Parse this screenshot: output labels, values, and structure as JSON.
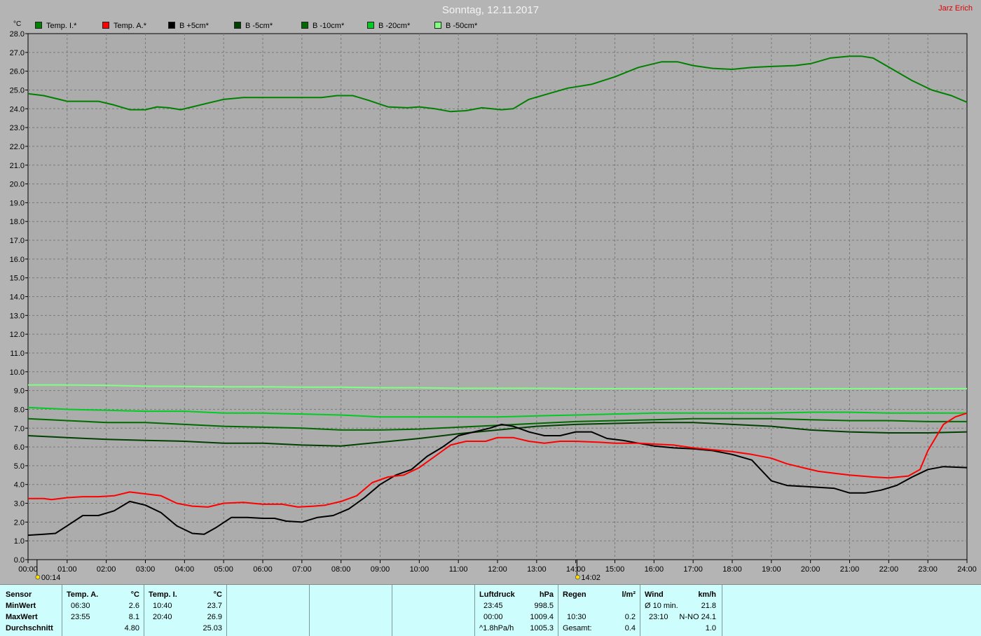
{
  "title": "Sonntag, 12.11.2017",
  "author": "Jarz Erich",
  "colors": {
    "temp_i": "#008000",
    "temp_a": "#ff0000",
    "b_plus5": "#000000",
    "b_minus5": "#004000",
    "b_minus10": "#006a00",
    "b_minus20": "#00cc22",
    "b_minus50": "#80ff80"
  },
  "chart_data": {
    "type": "line",
    "ylabel": "°C",
    "ylim": [
      0,
      28
    ],
    "xlim": [
      0,
      24
    ],
    "grid": true,
    "legend_placement": "top",
    "y_ticks": [
      "0.0",
      "1.0",
      "2.0",
      "3.0",
      "4.0",
      "5.0",
      "6.0",
      "7.0",
      "8.0",
      "9.0",
      "10.0",
      "11.0",
      "12.0",
      "13.0",
      "14.0",
      "15.0",
      "16.0",
      "17.0",
      "18.0",
      "19.0",
      "20.0",
      "21.0",
      "22.0",
      "23.0",
      "24.0",
      "25.0",
      "26.0",
      "27.0",
      "28.0"
    ],
    "x_ticks": [
      "00:00",
      "01:00",
      "02:00",
      "03:00",
      "04:00",
      "05:00",
      "06:00",
      "07:00",
      "08:00",
      "09:00",
      "10:00",
      "11:00",
      "12:00",
      "13:00",
      "14:00",
      "15:00",
      "16:00",
      "17:00",
      "18:00",
      "19:00",
      "20:00",
      "21:00",
      "22:00",
      "23:00",
      "24:00"
    ],
    "markers": [
      {
        "x": 0.23,
        "label": "00:14"
      },
      {
        "x": 14.03,
        "label": "14:02"
      }
    ],
    "series": [
      {
        "name": "Temp. I.*",
        "color_key": "temp_i",
        "points": [
          [
            0,
            24.8
          ],
          [
            0.4,
            24.7
          ],
          [
            0.8,
            24.5
          ],
          [
            1,
            24.4
          ],
          [
            1.5,
            24.4
          ],
          [
            1.8,
            24.4
          ],
          [
            2.2,
            24.2
          ],
          [
            2.6,
            23.95
          ],
          [
            3,
            23.95
          ],
          [
            3.3,
            24.1
          ],
          [
            3.6,
            24.05
          ],
          [
            3.9,
            23.95
          ],
          [
            4.2,
            24.1
          ],
          [
            4.6,
            24.3
          ],
          [
            5,
            24.5
          ],
          [
            5.5,
            24.6
          ],
          [
            6,
            24.6
          ],
          [
            6.6,
            24.6
          ],
          [
            7,
            24.6
          ],
          [
            7.5,
            24.6
          ],
          [
            7.9,
            24.7
          ],
          [
            8.3,
            24.7
          ],
          [
            8.7,
            24.45
          ],
          [
            9.2,
            24.1
          ],
          [
            9.7,
            24.05
          ],
          [
            10,
            24.1
          ],
          [
            10.4,
            24.0
          ],
          [
            10.8,
            23.85
          ],
          [
            11.2,
            23.9
          ],
          [
            11.6,
            24.05
          ],
          [
            12.1,
            23.95
          ],
          [
            12.4,
            24.0
          ],
          [
            12.8,
            24.5
          ],
          [
            13.3,
            24.8
          ],
          [
            13.8,
            25.1
          ],
          [
            14.4,
            25.3
          ],
          [
            15,
            25.7
          ],
          [
            15.6,
            26.2
          ],
          [
            16.2,
            26.5
          ],
          [
            16.6,
            26.5
          ],
          [
            17,
            26.3
          ],
          [
            17.5,
            26.15
          ],
          [
            18,
            26.1
          ],
          [
            18.5,
            26.2
          ],
          [
            19,
            26.25
          ],
          [
            19.6,
            26.3
          ],
          [
            20,
            26.4
          ],
          [
            20.5,
            26.7
          ],
          [
            21,
            26.8
          ],
          [
            21.3,
            26.8
          ],
          [
            21.6,
            26.7
          ],
          [
            22.1,
            26.1
          ],
          [
            22.6,
            25.5
          ],
          [
            23.1,
            25.0
          ],
          [
            23.6,
            24.7
          ],
          [
            24,
            24.35
          ]
        ]
      },
      {
        "name": "Temp. A.*",
        "color_key": "temp_a",
        "points": [
          [
            0,
            3.25
          ],
          [
            0.4,
            3.25
          ],
          [
            0.6,
            3.2
          ],
          [
            1,
            3.3
          ],
          [
            1.4,
            3.35
          ],
          [
            1.8,
            3.35
          ],
          [
            2.2,
            3.4
          ],
          [
            2.6,
            3.6
          ],
          [
            3,
            3.5
          ],
          [
            3.4,
            3.4
          ],
          [
            3.8,
            3.0
          ],
          [
            4.2,
            2.85
          ],
          [
            4.6,
            2.8
          ],
          [
            5,
            3.0
          ],
          [
            5.5,
            3.05
          ],
          [
            6,
            2.95
          ],
          [
            6.5,
            2.95
          ],
          [
            6.9,
            2.8
          ],
          [
            7.3,
            2.85
          ],
          [
            7.6,
            2.9
          ],
          [
            8,
            3.1
          ],
          [
            8.4,
            3.4
          ],
          [
            8.8,
            4.1
          ],
          [
            9.2,
            4.4
          ],
          [
            9.6,
            4.5
          ],
          [
            10,
            4.9
          ],
          [
            10.4,
            5.5
          ],
          [
            10.8,
            6.1
          ],
          [
            11.2,
            6.3
          ],
          [
            11.7,
            6.3
          ],
          [
            12,
            6.5
          ],
          [
            12.4,
            6.5
          ],
          [
            12.8,
            6.3
          ],
          [
            13.2,
            6.2
          ],
          [
            13.6,
            6.3
          ],
          [
            14,
            6.3
          ],
          [
            14.6,
            6.25
          ],
          [
            15,
            6.2
          ],
          [
            15.6,
            6.2
          ],
          [
            16,
            6.15
          ],
          [
            16.5,
            6.1
          ],
          [
            17,
            5.95
          ],
          [
            17.5,
            5.85
          ],
          [
            18,
            5.75
          ],
          [
            18.5,
            5.6
          ],
          [
            19,
            5.4
          ],
          [
            19.4,
            5.1
          ],
          [
            19.8,
            4.9
          ],
          [
            20.2,
            4.7
          ],
          [
            20.6,
            4.6
          ],
          [
            21,
            4.5
          ],
          [
            21.6,
            4.4
          ],
          [
            22,
            4.35
          ],
          [
            22.5,
            4.45
          ],
          [
            22.8,
            4.8
          ],
          [
            23,
            5.8
          ],
          [
            23.4,
            7.2
          ],
          [
            23.7,
            7.6
          ],
          [
            24,
            7.8
          ]
        ]
      },
      {
        "name": "B +5cm*",
        "color_key": "b_plus5",
        "points": [
          [
            0,
            1.3
          ],
          [
            0.4,
            1.35
          ],
          [
            0.7,
            1.4
          ],
          [
            1,
            1.8
          ],
          [
            1.4,
            2.35
          ],
          [
            1.8,
            2.35
          ],
          [
            2.2,
            2.6
          ],
          [
            2.6,
            3.1
          ],
          [
            3,
            2.9
          ],
          [
            3.4,
            2.5
          ],
          [
            3.8,
            1.8
          ],
          [
            4.2,
            1.4
          ],
          [
            4.5,
            1.35
          ],
          [
            4.8,
            1.7
          ],
          [
            5.2,
            2.25
          ],
          [
            5.6,
            2.25
          ],
          [
            6,
            2.2
          ],
          [
            6.3,
            2.2
          ],
          [
            6.6,
            2.05
          ],
          [
            7,
            2.0
          ],
          [
            7.4,
            2.25
          ],
          [
            7.8,
            2.35
          ],
          [
            8.2,
            2.7
          ],
          [
            8.6,
            3.3
          ],
          [
            9,
            4.0
          ],
          [
            9.4,
            4.5
          ],
          [
            9.8,
            4.8
          ],
          [
            10.2,
            5.5
          ],
          [
            10.6,
            6.0
          ],
          [
            11,
            6.6
          ],
          [
            11.4,
            6.8
          ],
          [
            11.8,
            7.0
          ],
          [
            12.1,
            7.2
          ],
          [
            12.4,
            7.1
          ],
          [
            12.8,
            6.8
          ],
          [
            13.2,
            6.6
          ],
          [
            13.6,
            6.6
          ],
          [
            14,
            6.8
          ],
          [
            14.4,
            6.8
          ],
          [
            14.8,
            6.45
          ],
          [
            15.2,
            6.35
          ],
          [
            15.6,
            6.2
          ],
          [
            16,
            6.05
          ],
          [
            16.5,
            5.95
          ],
          [
            17,
            5.9
          ],
          [
            17.5,
            5.8
          ],
          [
            18,
            5.6
          ],
          [
            18.5,
            5.3
          ],
          [
            19,
            4.2
          ],
          [
            19.4,
            3.95
          ],
          [
            19.8,
            3.9
          ],
          [
            20.2,
            3.85
          ],
          [
            20.6,
            3.8
          ],
          [
            21,
            3.55
          ],
          [
            21.4,
            3.55
          ],
          [
            21.8,
            3.7
          ],
          [
            22.2,
            3.95
          ],
          [
            22.6,
            4.4
          ],
          [
            23,
            4.8
          ],
          [
            23.4,
            4.95
          ],
          [
            24,
            4.9
          ]
        ]
      },
      {
        "name": "B -5cm*",
        "color_key": "b_minus5",
        "points": [
          [
            0,
            6.6
          ],
          [
            1,
            6.5
          ],
          [
            2,
            6.4
          ],
          [
            3,
            6.35
          ],
          [
            4,
            6.3
          ],
          [
            5,
            6.2
          ],
          [
            6,
            6.2
          ],
          [
            7,
            6.1
          ],
          [
            8,
            6.05
          ],
          [
            9,
            6.25
          ],
          [
            10,
            6.45
          ],
          [
            11,
            6.7
          ],
          [
            12,
            6.9
          ],
          [
            13,
            7.1
          ],
          [
            14,
            7.2
          ],
          [
            15,
            7.25
          ],
          [
            16,
            7.3
          ],
          [
            17,
            7.3
          ],
          [
            18,
            7.2
          ],
          [
            19,
            7.1
          ],
          [
            20,
            6.9
          ],
          [
            21,
            6.8
          ],
          [
            22,
            6.75
          ],
          [
            23,
            6.75
          ],
          [
            24,
            6.8
          ]
        ]
      },
      {
        "name": "B -10cm*",
        "color_key": "b_minus10",
        "points": [
          [
            0,
            7.5
          ],
          [
            1,
            7.4
          ],
          [
            2,
            7.3
          ],
          [
            3,
            7.3
          ],
          [
            4,
            7.2
          ],
          [
            5,
            7.1
          ],
          [
            6,
            7.05
          ],
          [
            7,
            7.0
          ],
          [
            8,
            6.9
          ],
          [
            9,
            6.9
          ],
          [
            10,
            6.95
          ],
          [
            11,
            7.05
          ],
          [
            12,
            7.15
          ],
          [
            13,
            7.25
          ],
          [
            14,
            7.35
          ],
          [
            15,
            7.4
          ],
          [
            16,
            7.45
          ],
          [
            17,
            7.5
          ],
          [
            18,
            7.5
          ],
          [
            19,
            7.5
          ],
          [
            20,
            7.45
          ],
          [
            21,
            7.4
          ],
          [
            22,
            7.4
          ],
          [
            23,
            7.35
          ],
          [
            24,
            7.35
          ]
        ]
      },
      {
        "name": "B -20cm*",
        "color_key": "b_minus20",
        "points": [
          [
            0,
            8.1
          ],
          [
            1,
            8.0
          ],
          [
            2,
            7.95
          ],
          [
            3,
            7.9
          ],
          [
            4,
            7.9
          ],
          [
            5,
            7.8
          ],
          [
            6,
            7.8
          ],
          [
            7,
            7.75
          ],
          [
            8,
            7.7
          ],
          [
            9,
            7.6
          ],
          [
            10,
            7.6
          ],
          [
            11,
            7.6
          ],
          [
            12,
            7.6
          ],
          [
            13,
            7.65
          ],
          [
            14,
            7.7
          ],
          [
            15,
            7.75
          ],
          [
            16,
            7.8
          ],
          [
            17,
            7.8
          ],
          [
            18,
            7.8
          ],
          [
            19,
            7.8
          ],
          [
            20,
            7.85
          ],
          [
            21,
            7.85
          ],
          [
            22,
            7.8
          ],
          [
            23,
            7.8
          ],
          [
            24,
            7.8
          ]
        ]
      },
      {
        "name": "B -50cm*",
        "color_key": "b_minus50",
        "points": [
          [
            0,
            9.3
          ],
          [
            1,
            9.3
          ],
          [
            2,
            9.28
          ],
          [
            3,
            9.23
          ],
          [
            4,
            9.22
          ],
          [
            5,
            9.2
          ],
          [
            6,
            9.2
          ],
          [
            7,
            9.18
          ],
          [
            8,
            9.18
          ],
          [
            9,
            9.15
          ],
          [
            10,
            9.15
          ],
          [
            11,
            9.12
          ],
          [
            12,
            9.12
          ],
          [
            13,
            9.12
          ],
          [
            14,
            9.1
          ],
          [
            15,
            9.1
          ],
          [
            16,
            9.1
          ],
          [
            17,
            9.1
          ],
          [
            18,
            9.1
          ],
          [
            19,
            9.1
          ],
          [
            20,
            9.1
          ],
          [
            21,
            9.1
          ],
          [
            22,
            9.1
          ],
          [
            23,
            9.1
          ],
          [
            24,
            9.1
          ]
        ]
      }
    ]
  },
  "table": {
    "sensor_col": {
      "header": "Sensor",
      "rows": [
        "MinWert",
        "MaxWert",
        "Durchschnitt"
      ]
    },
    "temp_a": {
      "header": "Temp. A.",
      "unit": "°C",
      "min_time": "06:30",
      "min_value": "2.6",
      "max_time": "23:55",
      "max_value": "8.1",
      "avg": "4.80"
    },
    "temp_i": {
      "header": "Temp. I.",
      "unit": "°C",
      "min_time": "10:40",
      "min_value": "23.7",
      "max_time": "20:40",
      "max_value": "26.9",
      "avg": "25.03"
    },
    "pressure": {
      "header": "Luftdruck",
      "unit": "hPa",
      "min_time": "23:45",
      "min_value": "998.5",
      "max_time": "00:00",
      "max_value": "1009.4",
      "trend_label": "^1.8hPa/h",
      "avg": "1005.3"
    },
    "rain": {
      "header": "Regen",
      "unit": "l/m²",
      "max_time": "10:30",
      "max_value": "0.2",
      "total_label": "Gesamt:",
      "total": "0.4"
    },
    "wind": {
      "header": "Wind",
      "unit": "km/h",
      "avg_label": "Ø 10 min.",
      "avg_value": "21.8",
      "max_time": "23:10",
      "max_value": "N-NO 24.1",
      "avg": "1.0"
    }
  }
}
